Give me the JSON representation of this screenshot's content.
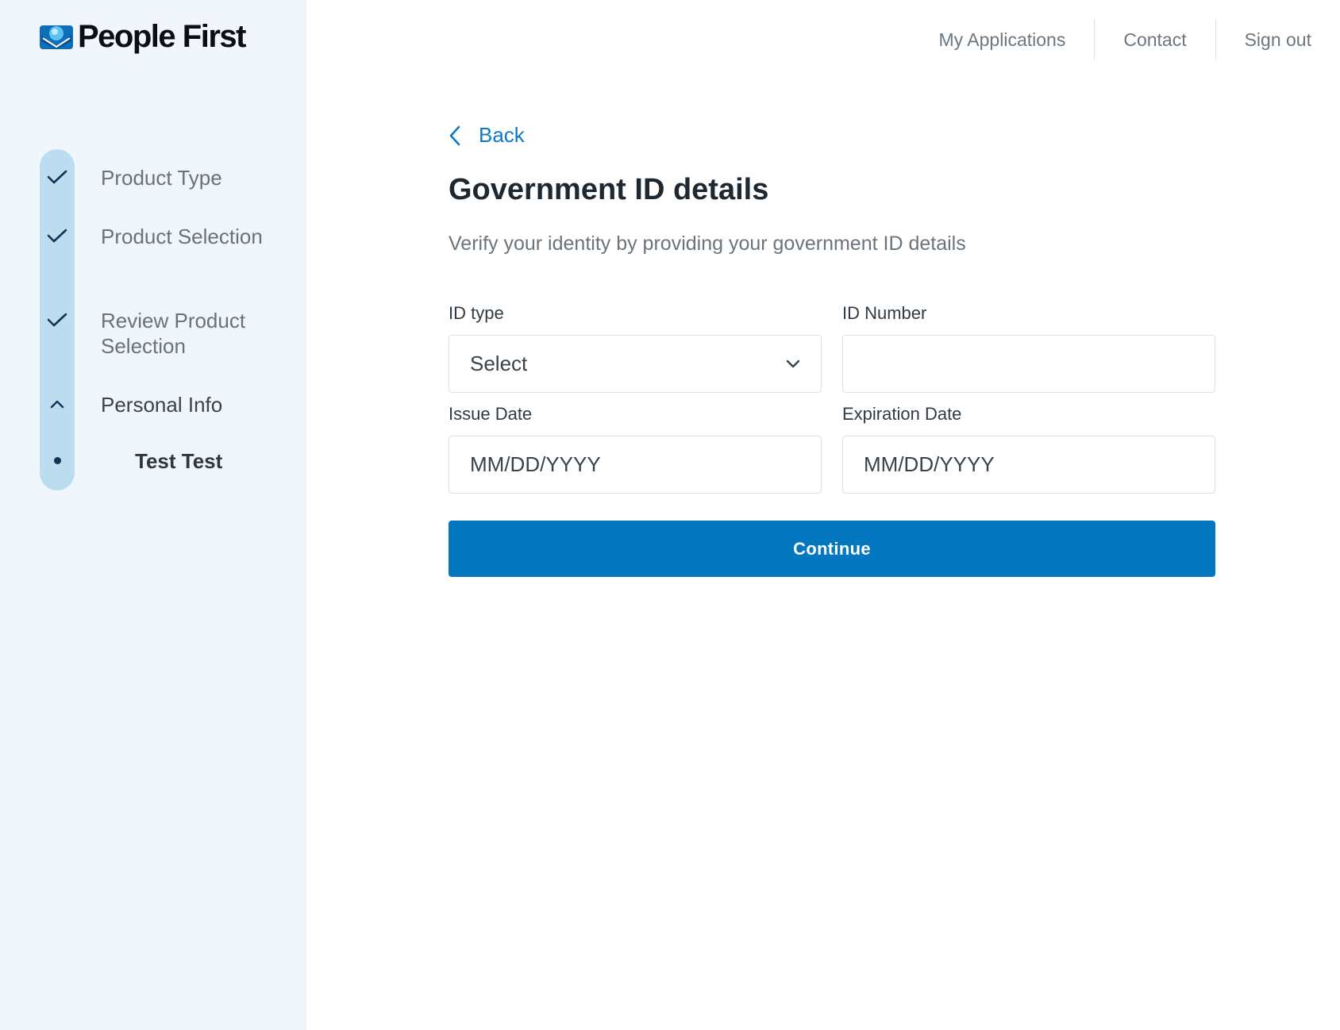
{
  "brand": {
    "name": "People First",
    "colors": {
      "primary": "#0477c1",
      "sidebar_bg": "#f1f6fb",
      "step_track": "#bcdcef",
      "check": "#0e3555"
    }
  },
  "topnav": {
    "items": [
      {
        "label": "My Applications"
      },
      {
        "label": "Contact"
      },
      {
        "label": "Sign out"
      }
    ]
  },
  "sidebar": {
    "steps": [
      {
        "label": "Product Type",
        "icon": "check-icon",
        "state": "complete"
      },
      {
        "label": "Product Selection",
        "icon": "check-icon",
        "state": "complete"
      },
      {
        "label": "Review Product Selection",
        "icon": "check-icon",
        "state": "complete"
      },
      {
        "label": "Personal Info",
        "icon": "chevron-up-icon",
        "state": "active"
      },
      {
        "label": "Test Test",
        "icon": "dot-icon",
        "state": "current-substep"
      }
    ]
  },
  "main": {
    "back_label": "Back",
    "title": "Government ID details",
    "subtitle": "Verify your identity by providing your government ID details",
    "fields": {
      "id_type": {
        "label": "ID type",
        "value": "Select"
      },
      "id_number": {
        "label": "ID Number",
        "value": "",
        "placeholder": ""
      },
      "issue_date": {
        "label": "Issue Date",
        "value": "",
        "placeholder": "MM/DD/YYYY"
      },
      "expiration_date": {
        "label": "Expiration Date",
        "value": "",
        "placeholder": "MM/DD/YYYY"
      }
    },
    "continue_label": "Continue"
  }
}
